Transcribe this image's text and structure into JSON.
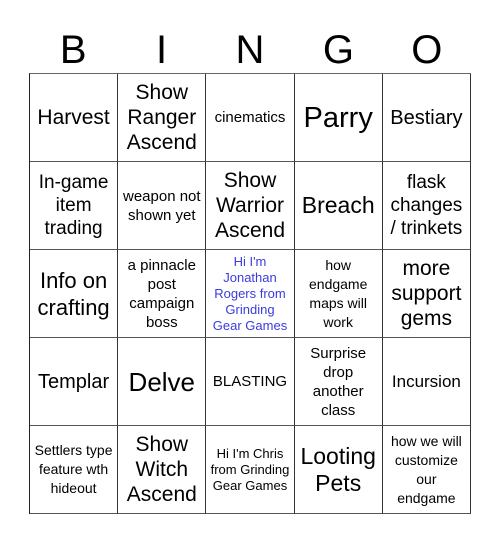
{
  "header": {
    "letters": [
      "B",
      "I",
      "N",
      "G",
      "O"
    ]
  },
  "colors": {
    "free_space_text": "#3b3be0",
    "grid_line": "#333333",
    "text": "#000000"
  },
  "board": {
    "rows": [
      [
        "Harvest",
        "Show Ranger Ascend",
        "cinematics",
        "Parry",
        "Bestiary"
      ],
      [
        "In-game item trading",
        "weapon not shown yet",
        "Show Warrior Ascend",
        "Breach",
        "flask changes / trinkets"
      ],
      [
        "Info on crafting",
        "a pinnacle post campaign boss",
        "Hi I'm Jonathan Rogers from Grinding Gear Games",
        "how endgame maps will work",
        "more support gems"
      ],
      [
        "Templar",
        "Delve",
        "BLASTING",
        "Surprise drop another class",
        "Incursion"
      ],
      [
        "Settlers type feature wth hideout",
        "Show Witch Ascend",
        "Hi I'm Chris from Grinding Gear Games",
        "Looting Pets",
        "how we will customize our endgame"
      ]
    ],
    "free_space": {
      "row": 2,
      "col": 2
    }
  }
}
